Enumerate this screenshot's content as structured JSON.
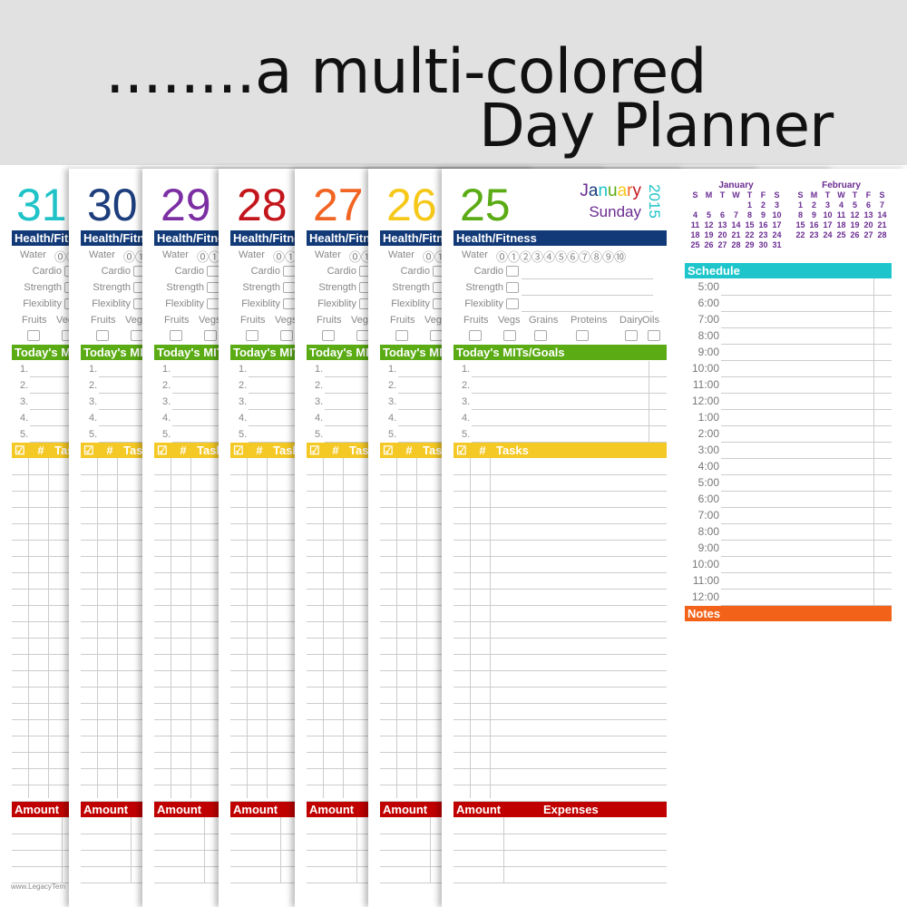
{
  "banner": {
    "line1": "........a multi-colored",
    "line2": "Day Planner"
  },
  "pages": [
    {
      "day": "31",
      "color": "#1fc3c8"
    },
    {
      "day": "30",
      "color": "#1d3d7c"
    },
    {
      "day": "29",
      "color": "#7b2fa3"
    },
    {
      "day": "28",
      "color": "#c3161c"
    },
    {
      "day": "27",
      "color": "#f26423"
    },
    {
      "day": "26",
      "color": "#f6c81a"
    },
    {
      "day": "25",
      "color": "#5aab14"
    }
  ],
  "front": {
    "month": "January",
    "weekday": "Sunday",
    "year": "2015"
  },
  "labels": {
    "health": "Health/Fitness",
    "water": "Water",
    "cardio": "Cardio",
    "strength": "Strength",
    "flexibility": "Flexiblity",
    "foods": [
      "Fruits",
      "Vegs",
      "Grains",
      "Proteins",
      "Dairy",
      "Oils"
    ],
    "mits": "Today's MITs/Goals",
    "mit_numbers": [
      "1.",
      "2.",
      "3.",
      "4.",
      "5."
    ],
    "task_check": "☑",
    "task_hash": "#",
    "tasks": "Tasks",
    "amount": "Amount",
    "expenses": "Expenses",
    "schedule": "Schedule",
    "notes": "Notes",
    "water_circles": [
      "⓪",
      "①",
      "②",
      "③",
      "④",
      "⑤",
      "⑥",
      "⑦",
      "⑧",
      "⑨",
      "⑩"
    ]
  },
  "bar_colors": {
    "health": "#123a78",
    "mits": "#5aab14",
    "tasks": "#f4c825",
    "amount": "#c00000",
    "schedule": "#1ec6cc",
    "notes": "#f26218"
  },
  "schedule_times": [
    "5:00",
    "6:00",
    "7:00",
    "8:00",
    "9:00",
    "10:00",
    "11:00",
    "12:00",
    "1:00",
    "2:00",
    "3:00",
    "4:00",
    "5:00",
    "6:00",
    "7:00",
    "8:00",
    "9:00",
    "10:00",
    "11:00",
    "12:00"
  ],
  "calendars": [
    {
      "month": "January",
      "weekdays": [
        "S",
        "M",
        "T",
        "W",
        "T",
        "F",
        "S"
      ],
      "weeks": [
        [
          "",
          "",
          "",
          "",
          "1",
          "2",
          "3"
        ],
        [
          "4",
          "5",
          "6",
          "7",
          "8",
          "9",
          "10"
        ],
        [
          "11",
          "12",
          "13",
          "14",
          "15",
          "16",
          "17"
        ],
        [
          "18",
          "19",
          "20",
          "21",
          "22",
          "23",
          "24"
        ],
        [
          "25",
          "26",
          "27",
          "28",
          "29",
          "30",
          "31"
        ]
      ]
    },
    {
      "month": "February",
      "weekdays": [
        "S",
        "M",
        "T",
        "W",
        "T",
        "F",
        "S"
      ],
      "weeks": [
        [
          "1",
          "2",
          "3",
          "4",
          "5",
          "6",
          "7"
        ],
        [
          "8",
          "9",
          "10",
          "11",
          "12",
          "13",
          "14"
        ],
        [
          "15",
          "16",
          "17",
          "18",
          "19",
          "20",
          "21"
        ],
        [
          "22",
          "23",
          "24",
          "25",
          "26",
          "27",
          "28"
        ]
      ]
    }
  ],
  "footer": "www.LegacyTem",
  "month_letter_colors": [
    "#6a2c91",
    "#1d3d7c",
    "#1fc3c8",
    "#5aab14",
    "#f6c81a",
    "#f26423",
    "#c3161c"
  ]
}
